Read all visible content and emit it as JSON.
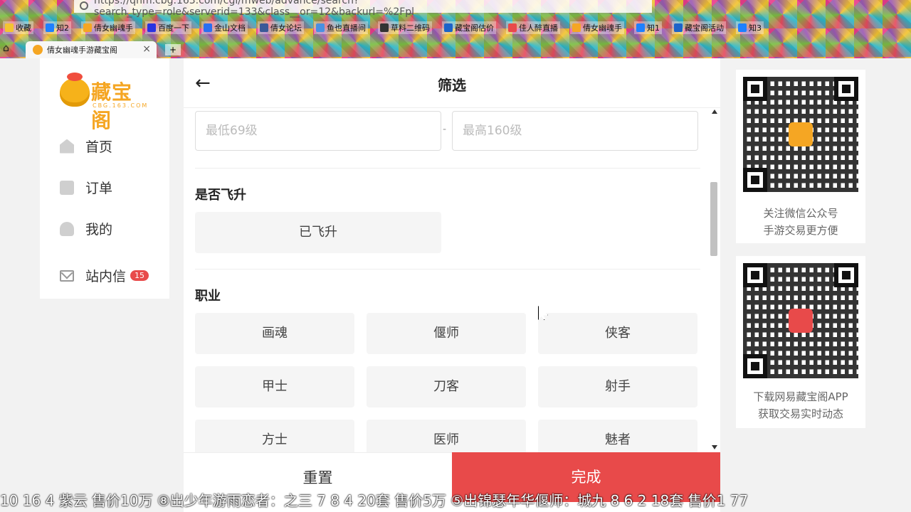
{
  "browser": {
    "url": "https://qnm.cbg.163.com/cgi/mweb/advance/search?search_type=role&serverid=133&class__or=12&backurl=%2Fpl",
    "bookmarks": [
      "收藏",
      "知2",
      "倩女幽魂手",
      "百度一下",
      "金山文档",
      "倩女论坛",
      "鱼也直播间",
      "草料二维码",
      "藏宝阁估价",
      "佳人醉直播",
      "倩女幽魂手",
      "知1",
      "藏宝阁活动",
      "知3"
    ],
    "tab_title": "倩女幽魂手游藏宝阁",
    "tab_close": "×",
    "newtab": "+"
  },
  "sidebar": {
    "logo_name": "藏宝阁",
    "logo_domain": "CBG.163.COM",
    "nav": [
      "首页",
      "订单",
      "我的"
    ],
    "inbox_label": "站内信",
    "inbox_count": "15"
  },
  "filter": {
    "back": "←",
    "title": "筛选",
    "level_min_placeholder": "最低69级",
    "level_max_placeholder": "最高160级",
    "range_dash": "-",
    "ascend_title": "是否飞升",
    "ascend_option": "已飞升",
    "class_title": "职业",
    "classes": [
      "画魂",
      "偃师",
      "侠客",
      "甲士",
      "刀客",
      "射手",
      "方士",
      "医师",
      "魅者"
    ],
    "reset_label": "重置",
    "done_label": "完成"
  },
  "qr": {
    "card1_line1": "关注微信公众号",
    "card1_line2": "手游交易更方便",
    "card2_line1": "下载网易藏宝阁APP",
    "card2_line2": "获取交易实时动态"
  },
  "ticker": "10 16 4 紫云 售价10万 ⑧出少年游雨恋者：之三 7 8 4 20套 售价5万 ⑤出锦瑟年华偃师：城九 8 6 2 18套 售价1 77",
  "colors": {
    "accent": "#e84a4a",
    "logo": "#f5a623",
    "badge": "#e84b4b"
  }
}
